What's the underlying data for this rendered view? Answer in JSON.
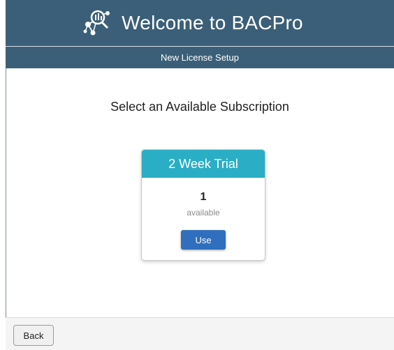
{
  "header": {
    "logo_icon": "molecule-network-icon",
    "title": "Welcome to BACPro",
    "subtitle": "New License Setup",
    "background_color": "#3b5f78"
  },
  "main": {
    "heading": "Select an Available Subscription"
  },
  "subscriptions": [
    {
      "name": "2 Week Trial",
      "count": "1",
      "count_label": "available",
      "action_label": "Use",
      "header_color": "#2aaec5",
      "button_color": "#2f6fbd"
    }
  ],
  "footer": {
    "back_label": "Back"
  }
}
